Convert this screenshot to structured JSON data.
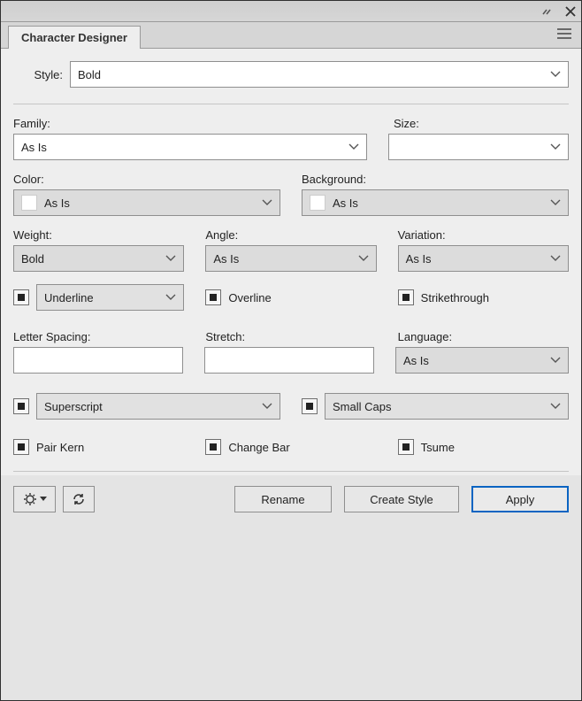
{
  "titlebar": {},
  "tabs": {
    "active": "Character Designer"
  },
  "style": {
    "label": "Style:",
    "value": "Bold"
  },
  "family": {
    "label": "Family:",
    "value": "As Is"
  },
  "size": {
    "label": "Size:",
    "value": ""
  },
  "color": {
    "label": "Color:",
    "value": "As Is"
  },
  "background": {
    "label": "Background:",
    "value": "As Is"
  },
  "weight": {
    "label": "Weight:",
    "value": "Bold"
  },
  "angle": {
    "label": "Angle:",
    "value": "As Is"
  },
  "variation": {
    "label": "Variation:",
    "value": "As Is"
  },
  "underline": {
    "value": "Underline"
  },
  "overline": {
    "label": "Overline"
  },
  "strikethrough": {
    "label": "Strikethrough"
  },
  "letterSpacing": {
    "label": "Letter Spacing:",
    "value": ""
  },
  "stretch": {
    "label": "Stretch:",
    "value": ""
  },
  "language": {
    "label": "Language:",
    "value": "As Is"
  },
  "superscript": {
    "value": "Superscript"
  },
  "smallcaps": {
    "value": "Small Caps"
  },
  "pairkern": {
    "label": "Pair Kern"
  },
  "changebar": {
    "label": "Change Bar"
  },
  "tsume": {
    "label": "Tsume"
  },
  "buttons": {
    "rename": "Rename",
    "createStyle": "Create Style",
    "apply": "Apply"
  }
}
